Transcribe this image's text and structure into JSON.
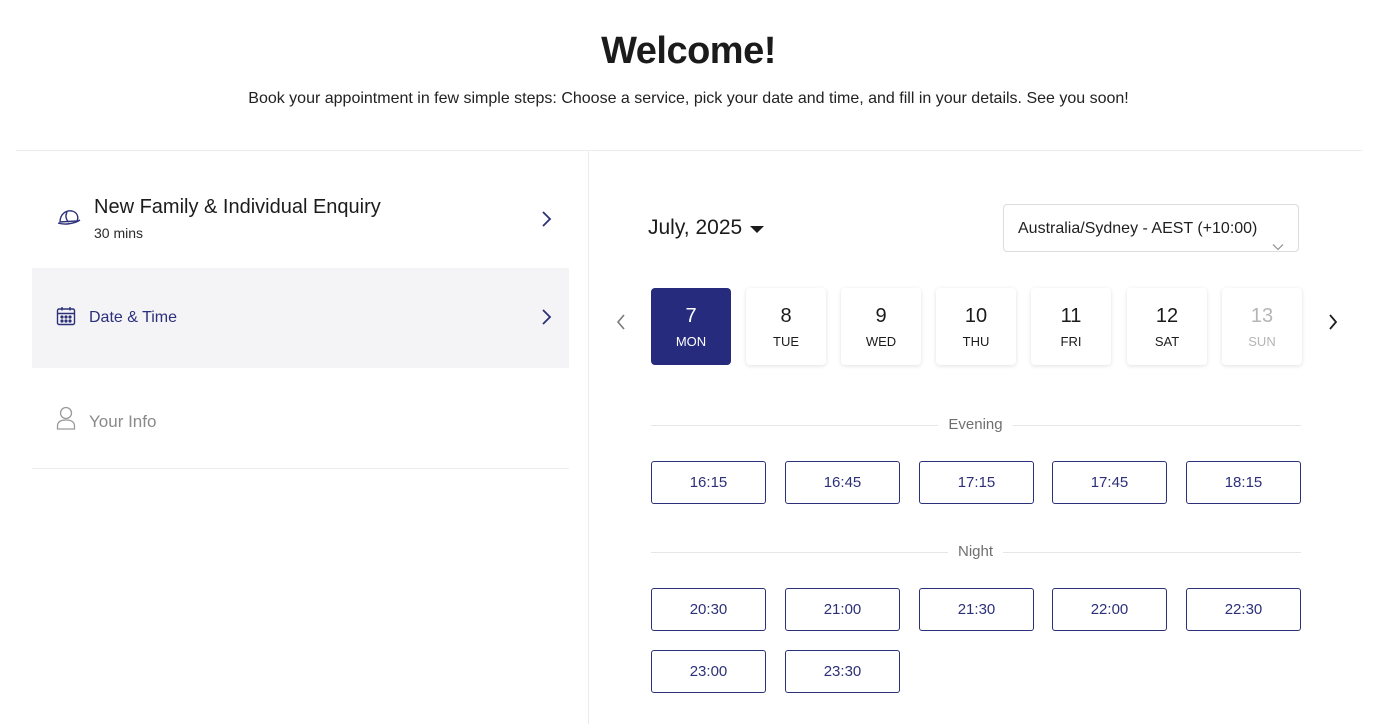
{
  "header": {
    "title": "Welcome!",
    "subtitle": "Book your appointment in few simple steps: Choose a service, pick your date and time, and fill in your details. See you soon!"
  },
  "steps": {
    "service": {
      "name": "New Family & Individual Enquiry",
      "duration": "30 mins",
      "icon": "hat-icon"
    },
    "datetime": {
      "label": "Date & Time",
      "icon": "calendar-icon"
    },
    "info": {
      "label": "Your Info",
      "icon": "user-icon"
    }
  },
  "calendar": {
    "month": "July, 2025",
    "timezone": "Australia/Sydney - AEST (+10:00)",
    "days": [
      {
        "num": "7",
        "name": "MON",
        "state": "selected"
      },
      {
        "num": "8",
        "name": "TUE",
        "state": "available"
      },
      {
        "num": "9",
        "name": "WED",
        "state": "available"
      },
      {
        "num": "10",
        "name": "THU",
        "state": "available"
      },
      {
        "num": "11",
        "name": "FRI",
        "state": "available"
      },
      {
        "num": "12",
        "name": "SAT",
        "state": "available"
      },
      {
        "num": "13",
        "name": "SUN",
        "state": "disabled"
      }
    ]
  },
  "slots": {
    "evening": {
      "label": "Evening",
      "times": [
        "16:15",
        "16:45",
        "17:15",
        "17:45",
        "18:15"
      ]
    },
    "night": {
      "label": "Night",
      "times": [
        "20:30",
        "21:00",
        "21:30",
        "22:00",
        "22:30",
        "23:00",
        "23:30"
      ]
    }
  },
  "colors": {
    "accent": "#262b7e",
    "slot_border": "#2c3078",
    "selected_step_bg": "#f4f4f7"
  }
}
